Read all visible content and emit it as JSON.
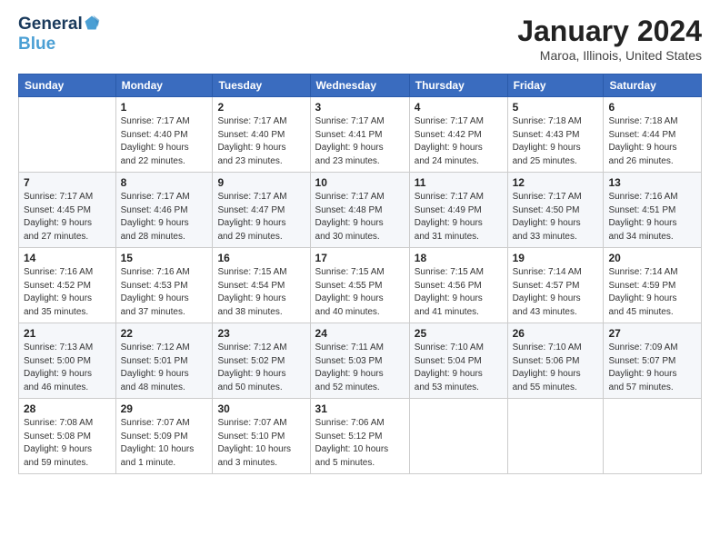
{
  "header": {
    "logo_line1": "General",
    "logo_line2": "Blue",
    "month_title": "January 2024",
    "location": "Maroa, Illinois, United States"
  },
  "days_of_week": [
    "Sunday",
    "Monday",
    "Tuesday",
    "Wednesday",
    "Thursday",
    "Friday",
    "Saturday"
  ],
  "weeks": [
    [
      {
        "day": "",
        "info": ""
      },
      {
        "day": "1",
        "info": "Sunrise: 7:17 AM\nSunset: 4:40 PM\nDaylight: 9 hours\nand 22 minutes."
      },
      {
        "day": "2",
        "info": "Sunrise: 7:17 AM\nSunset: 4:40 PM\nDaylight: 9 hours\nand 23 minutes."
      },
      {
        "day": "3",
        "info": "Sunrise: 7:17 AM\nSunset: 4:41 PM\nDaylight: 9 hours\nand 23 minutes."
      },
      {
        "day": "4",
        "info": "Sunrise: 7:17 AM\nSunset: 4:42 PM\nDaylight: 9 hours\nand 24 minutes."
      },
      {
        "day": "5",
        "info": "Sunrise: 7:18 AM\nSunset: 4:43 PM\nDaylight: 9 hours\nand 25 minutes."
      },
      {
        "day": "6",
        "info": "Sunrise: 7:18 AM\nSunset: 4:44 PM\nDaylight: 9 hours\nand 26 minutes."
      }
    ],
    [
      {
        "day": "7",
        "info": "Sunrise: 7:17 AM\nSunset: 4:45 PM\nDaylight: 9 hours\nand 27 minutes."
      },
      {
        "day": "8",
        "info": "Sunrise: 7:17 AM\nSunset: 4:46 PM\nDaylight: 9 hours\nand 28 minutes."
      },
      {
        "day": "9",
        "info": "Sunrise: 7:17 AM\nSunset: 4:47 PM\nDaylight: 9 hours\nand 29 minutes."
      },
      {
        "day": "10",
        "info": "Sunrise: 7:17 AM\nSunset: 4:48 PM\nDaylight: 9 hours\nand 30 minutes."
      },
      {
        "day": "11",
        "info": "Sunrise: 7:17 AM\nSunset: 4:49 PM\nDaylight: 9 hours\nand 31 minutes."
      },
      {
        "day": "12",
        "info": "Sunrise: 7:17 AM\nSunset: 4:50 PM\nDaylight: 9 hours\nand 33 minutes."
      },
      {
        "day": "13",
        "info": "Sunrise: 7:16 AM\nSunset: 4:51 PM\nDaylight: 9 hours\nand 34 minutes."
      }
    ],
    [
      {
        "day": "14",
        "info": "Sunrise: 7:16 AM\nSunset: 4:52 PM\nDaylight: 9 hours\nand 35 minutes."
      },
      {
        "day": "15",
        "info": "Sunrise: 7:16 AM\nSunset: 4:53 PM\nDaylight: 9 hours\nand 37 minutes."
      },
      {
        "day": "16",
        "info": "Sunrise: 7:15 AM\nSunset: 4:54 PM\nDaylight: 9 hours\nand 38 minutes."
      },
      {
        "day": "17",
        "info": "Sunrise: 7:15 AM\nSunset: 4:55 PM\nDaylight: 9 hours\nand 40 minutes."
      },
      {
        "day": "18",
        "info": "Sunrise: 7:15 AM\nSunset: 4:56 PM\nDaylight: 9 hours\nand 41 minutes."
      },
      {
        "day": "19",
        "info": "Sunrise: 7:14 AM\nSunset: 4:57 PM\nDaylight: 9 hours\nand 43 minutes."
      },
      {
        "day": "20",
        "info": "Sunrise: 7:14 AM\nSunset: 4:59 PM\nDaylight: 9 hours\nand 45 minutes."
      }
    ],
    [
      {
        "day": "21",
        "info": "Sunrise: 7:13 AM\nSunset: 5:00 PM\nDaylight: 9 hours\nand 46 minutes."
      },
      {
        "day": "22",
        "info": "Sunrise: 7:12 AM\nSunset: 5:01 PM\nDaylight: 9 hours\nand 48 minutes."
      },
      {
        "day": "23",
        "info": "Sunrise: 7:12 AM\nSunset: 5:02 PM\nDaylight: 9 hours\nand 50 minutes."
      },
      {
        "day": "24",
        "info": "Sunrise: 7:11 AM\nSunset: 5:03 PM\nDaylight: 9 hours\nand 52 minutes."
      },
      {
        "day": "25",
        "info": "Sunrise: 7:10 AM\nSunset: 5:04 PM\nDaylight: 9 hours\nand 53 minutes."
      },
      {
        "day": "26",
        "info": "Sunrise: 7:10 AM\nSunset: 5:06 PM\nDaylight: 9 hours\nand 55 minutes."
      },
      {
        "day": "27",
        "info": "Sunrise: 7:09 AM\nSunset: 5:07 PM\nDaylight: 9 hours\nand 57 minutes."
      }
    ],
    [
      {
        "day": "28",
        "info": "Sunrise: 7:08 AM\nSunset: 5:08 PM\nDaylight: 9 hours\nand 59 minutes."
      },
      {
        "day": "29",
        "info": "Sunrise: 7:07 AM\nSunset: 5:09 PM\nDaylight: 10 hours\nand 1 minute."
      },
      {
        "day": "30",
        "info": "Sunrise: 7:07 AM\nSunset: 5:10 PM\nDaylight: 10 hours\nand 3 minutes."
      },
      {
        "day": "31",
        "info": "Sunrise: 7:06 AM\nSunset: 5:12 PM\nDaylight: 10 hours\nand 5 minutes."
      },
      {
        "day": "",
        "info": ""
      },
      {
        "day": "",
        "info": ""
      },
      {
        "day": "",
        "info": ""
      }
    ]
  ]
}
